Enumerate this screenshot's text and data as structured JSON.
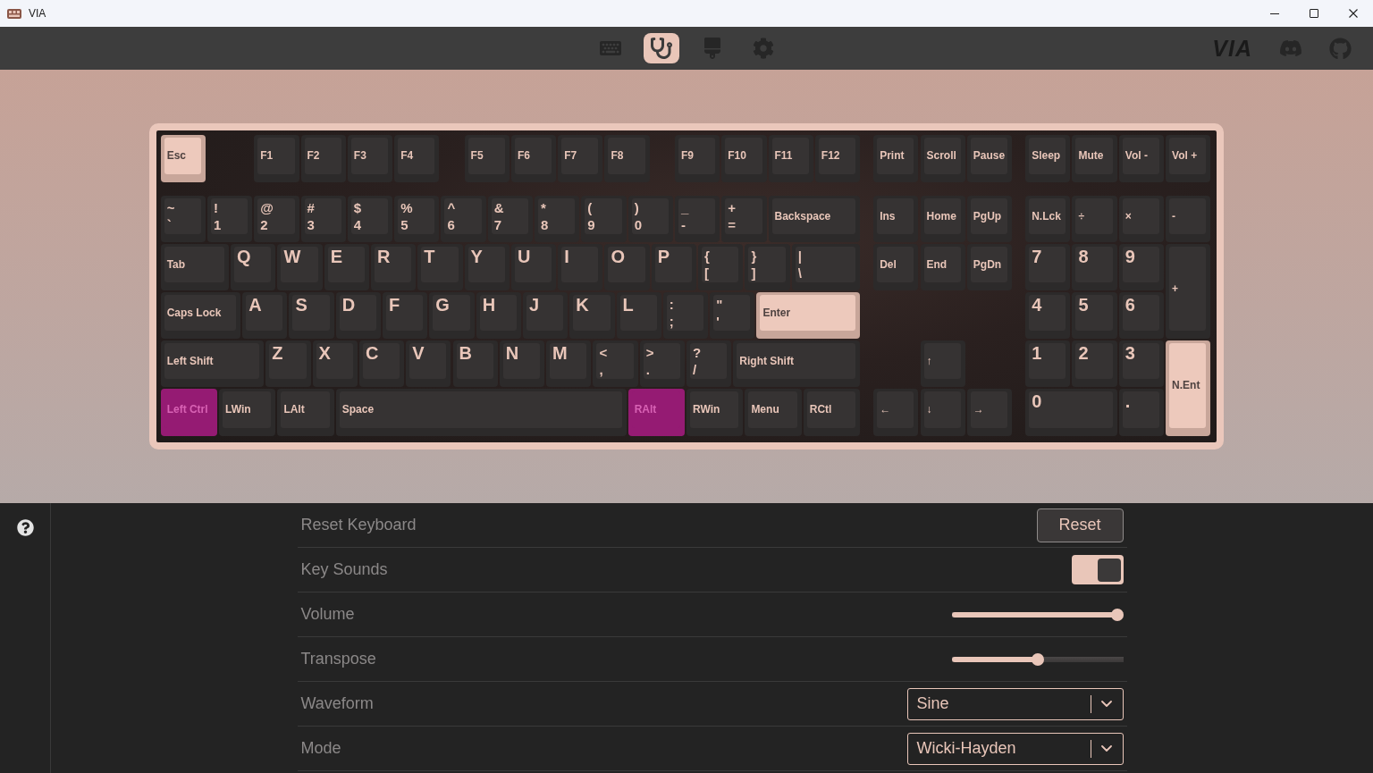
{
  "window": {
    "title": "VIA"
  },
  "nav": {
    "tabs": [
      {
        "kind": "configure",
        "selected": false
      },
      {
        "kind": "test",
        "selected": true
      },
      {
        "kind": "design",
        "selected": false
      },
      {
        "kind": "settings",
        "selected": false
      }
    ],
    "logo": "VIA"
  },
  "keyboard": {
    "rows": [
      {
        "keys": [
          {
            "kind": "word",
            "legend": "Esc",
            "tested": true,
            "held": false
          },
          {
            "kind": "word",
            "legend": "F1",
            "tested": false,
            "held": false
          },
          {
            "kind": "word",
            "legend": "F2",
            "tested": false,
            "held": false
          },
          {
            "kind": "word",
            "legend": "F3",
            "tested": false,
            "held": false
          },
          {
            "kind": "word",
            "legend": "F4",
            "tested": false,
            "held": false
          },
          {
            "kind": "word",
            "legend": "F5",
            "tested": false,
            "held": false
          },
          {
            "kind": "word",
            "legend": "F6",
            "tested": false,
            "held": false
          },
          {
            "kind": "word",
            "legend": "F7",
            "tested": false,
            "held": false
          },
          {
            "kind": "word",
            "legend": "F8",
            "tested": false,
            "held": false
          },
          {
            "kind": "word",
            "legend": "F9",
            "tested": false,
            "held": false
          },
          {
            "kind": "word",
            "legend": "F10",
            "tested": false,
            "held": false
          },
          {
            "kind": "word",
            "legend": "F11",
            "tested": false,
            "held": false
          },
          {
            "kind": "word",
            "legend": "F12",
            "tested": false,
            "held": false
          },
          {
            "kind": "word",
            "legend": "Print",
            "tested": false,
            "held": false
          },
          {
            "kind": "word",
            "legend": "Scroll",
            "tested": false,
            "held": false
          },
          {
            "kind": "word",
            "legend": "Pause",
            "tested": false,
            "held": false
          },
          {
            "kind": "word",
            "legend": "Sleep",
            "tested": false,
            "held": false
          },
          {
            "kind": "word",
            "legend": "Mute",
            "tested": false,
            "held": false
          },
          {
            "kind": "word",
            "legend": "Vol -",
            "tested": false,
            "held": false
          },
          {
            "kind": "word",
            "legend": "Vol +",
            "tested": false,
            "held": false
          }
        ]
      },
      {
        "keys": [
          {
            "kind": "dual",
            "upper": "~",
            "legend": "`",
            "tested": false,
            "held": false
          },
          {
            "kind": "dual",
            "upper": "!",
            "legend": "1",
            "tested": false,
            "held": false
          },
          {
            "kind": "dual",
            "upper": "@",
            "legend": "2",
            "tested": false,
            "held": false
          },
          {
            "kind": "dual",
            "upper": "#",
            "legend": "3",
            "tested": false,
            "held": false
          },
          {
            "kind": "dual",
            "upper": "$",
            "legend": "4",
            "tested": false,
            "held": false
          },
          {
            "kind": "dual",
            "upper": "%",
            "legend": "5",
            "tested": false,
            "held": false
          },
          {
            "kind": "dual",
            "upper": "^",
            "legend": "6",
            "tested": false,
            "held": false
          },
          {
            "kind": "dual",
            "upper": "&",
            "legend": "7",
            "tested": false,
            "held": false
          },
          {
            "kind": "dual",
            "upper": "*",
            "legend": "8",
            "tested": false,
            "held": false
          },
          {
            "kind": "dual",
            "upper": "(",
            "legend": "9",
            "tested": false,
            "held": false
          },
          {
            "kind": "dual",
            "upper": ")",
            "legend": "0",
            "tested": false,
            "held": false
          },
          {
            "kind": "dual",
            "upper": "_",
            "legend": "-",
            "tested": false,
            "held": false
          },
          {
            "kind": "dual",
            "upper": "+",
            "legend": "=",
            "tested": false,
            "held": false
          },
          {
            "kind": "word",
            "legend": "Backspace",
            "tested": false,
            "held": false
          },
          {
            "kind": "word",
            "legend": "Ins",
            "tested": false,
            "held": false
          },
          {
            "kind": "word",
            "legend": "Home",
            "tested": false,
            "held": false
          },
          {
            "kind": "word",
            "legend": "PgUp",
            "tested": false,
            "held": false
          },
          {
            "kind": "word",
            "legend": "N.Lck",
            "tested": false,
            "held": false
          },
          {
            "kind": "word",
            "legend": "÷",
            "tested": false,
            "held": false
          },
          {
            "kind": "word",
            "legend": "×",
            "tested": false,
            "held": false
          },
          {
            "kind": "word",
            "legend": "-",
            "tested": false,
            "held": false
          }
        ]
      },
      {
        "keys": [
          {
            "kind": "word",
            "legend": "Tab",
            "tested": false,
            "held": false
          },
          {
            "kind": "char",
            "legend": "Q",
            "tested": false,
            "held": false
          },
          {
            "kind": "char",
            "legend": "W",
            "tested": false,
            "held": false
          },
          {
            "kind": "char",
            "legend": "E",
            "tested": false,
            "held": false
          },
          {
            "kind": "char",
            "legend": "R",
            "tested": false,
            "held": false
          },
          {
            "kind": "char",
            "legend": "T",
            "tested": false,
            "held": false
          },
          {
            "kind": "char",
            "legend": "Y",
            "tested": false,
            "held": false
          },
          {
            "kind": "char",
            "legend": "U",
            "tested": false,
            "held": false
          },
          {
            "kind": "char",
            "legend": "I",
            "tested": false,
            "held": false
          },
          {
            "kind": "char",
            "legend": "O",
            "tested": false,
            "held": false
          },
          {
            "kind": "char",
            "legend": "P",
            "tested": false,
            "held": false
          },
          {
            "kind": "dual",
            "upper": "{",
            "legend": "[",
            "tested": false,
            "held": false
          },
          {
            "kind": "dual",
            "upper": "}",
            "legend": "]",
            "tested": false,
            "held": false
          },
          {
            "kind": "dual",
            "upper": "|",
            "legend": "\\",
            "tested": false,
            "held": false
          },
          {
            "kind": "word",
            "legend": "Del",
            "tested": false,
            "held": false
          },
          {
            "kind": "word",
            "legend": "End",
            "tested": false,
            "held": false
          },
          {
            "kind": "word",
            "legend": "PgDn",
            "tested": false,
            "held": false
          },
          {
            "kind": "char",
            "legend": "7",
            "tested": false,
            "held": false
          },
          {
            "kind": "char",
            "legend": "8",
            "tested": false,
            "held": false
          },
          {
            "kind": "char",
            "legend": "9",
            "tested": false,
            "held": false
          },
          {
            "kind": "word",
            "legend": "+",
            "tested": false,
            "held": false
          }
        ]
      },
      {
        "keys": [
          {
            "kind": "word",
            "legend": "Caps Lock",
            "tested": false,
            "held": false
          },
          {
            "kind": "char",
            "legend": "A",
            "tested": false,
            "held": false
          },
          {
            "kind": "char",
            "legend": "S",
            "tested": false,
            "held": false
          },
          {
            "kind": "char",
            "legend": "D",
            "tested": false,
            "held": false
          },
          {
            "kind": "char",
            "legend": "F",
            "tested": false,
            "held": false
          },
          {
            "kind": "char",
            "legend": "G",
            "tested": false,
            "held": false
          },
          {
            "kind": "char",
            "legend": "H",
            "tested": false,
            "held": false
          },
          {
            "kind": "char",
            "legend": "J",
            "tested": false,
            "held": false
          },
          {
            "kind": "char",
            "legend": "K",
            "tested": false,
            "held": false
          },
          {
            "kind": "char",
            "legend": "L",
            "tested": false,
            "held": false
          },
          {
            "kind": "dual",
            "upper": ":",
            "legend": ";",
            "tested": false,
            "held": false
          },
          {
            "kind": "dual",
            "upper": "\"",
            "legend": "'",
            "tested": false,
            "held": false
          },
          {
            "kind": "word",
            "legend": "Enter",
            "tested": true,
            "held": false
          },
          {
            "kind": "char",
            "legend": "4",
            "tested": false,
            "held": false
          },
          {
            "kind": "char",
            "legend": "5",
            "tested": false,
            "held": false
          },
          {
            "kind": "char",
            "legend": "6",
            "tested": false,
            "held": false
          }
        ]
      },
      {
        "keys": [
          {
            "kind": "word",
            "legend": "Left Shift",
            "tested": false,
            "held": false
          },
          {
            "kind": "char",
            "legend": "Z",
            "tested": false,
            "held": false
          },
          {
            "kind": "char",
            "legend": "X",
            "tested": false,
            "held": false
          },
          {
            "kind": "char",
            "legend": "C",
            "tested": false,
            "held": false
          },
          {
            "kind": "char",
            "legend": "V",
            "tested": false,
            "held": false
          },
          {
            "kind": "char",
            "legend": "B",
            "tested": false,
            "held": false
          },
          {
            "kind": "char",
            "legend": "N",
            "tested": false,
            "held": false
          },
          {
            "kind": "char",
            "legend": "M",
            "tested": false,
            "held": false
          },
          {
            "kind": "dual",
            "upper": "<",
            "legend": ",",
            "tested": false,
            "held": false
          },
          {
            "kind": "dual",
            "upper": ">",
            "legend": ".",
            "tested": false,
            "held": false
          },
          {
            "kind": "dual",
            "upper": "?",
            "legend": "/",
            "tested": false,
            "held": false
          },
          {
            "kind": "word",
            "legend": "Right Shift",
            "tested": false,
            "held": false
          },
          {
            "kind": "word",
            "legend": "↑",
            "tested": false,
            "held": false
          },
          {
            "kind": "char",
            "legend": "1",
            "tested": false,
            "held": false
          },
          {
            "kind": "char",
            "legend": "2",
            "tested": false,
            "held": false
          },
          {
            "kind": "char",
            "legend": "3",
            "tested": false,
            "held": false
          },
          {
            "kind": "word",
            "legend": "N.Ent",
            "tested": true,
            "held": false
          }
        ]
      },
      {
        "keys": [
          {
            "kind": "word",
            "legend": "Left Ctrl",
            "tested": false,
            "held": true
          },
          {
            "kind": "word",
            "legend": "LWin",
            "tested": false,
            "held": false
          },
          {
            "kind": "word",
            "legend": "LAlt",
            "tested": false,
            "held": false
          },
          {
            "kind": "word",
            "legend": "Space",
            "tested": false,
            "held": false
          },
          {
            "kind": "word",
            "legend": "RAlt",
            "tested": false,
            "held": true
          },
          {
            "kind": "word",
            "legend": "RWin",
            "tested": false,
            "held": false
          },
          {
            "kind": "word",
            "legend": "Menu",
            "tested": false,
            "held": false
          },
          {
            "kind": "word",
            "legend": "RCtl",
            "tested": false,
            "held": false
          },
          {
            "kind": "word",
            "legend": "←",
            "tested": false,
            "held": false
          },
          {
            "kind": "word",
            "legend": "↓",
            "tested": false,
            "held": false
          },
          {
            "kind": "word",
            "legend": "→",
            "tested": false,
            "held": false
          },
          {
            "kind": "char",
            "legend": "0",
            "tested": false,
            "held": false
          },
          {
            "kind": "char",
            "legend": ".",
            "tested": false,
            "held": false
          }
        ]
      }
    ]
  },
  "settings": {
    "rows": [
      {
        "kind": "button",
        "label": "Reset Keyboard",
        "button": "Reset"
      },
      {
        "kind": "toggle",
        "label": "Key Sounds",
        "on": true
      },
      {
        "kind": "slider",
        "label": "Volume",
        "level": 1.0
      },
      {
        "kind": "slider",
        "label": "Transpose",
        "level": 0.5
      },
      {
        "kind": "select",
        "label": "Waveform",
        "value": "Sine"
      },
      {
        "kind": "select",
        "label": "Mode",
        "value": "Wicki-Hayden"
      }
    ]
  }
}
